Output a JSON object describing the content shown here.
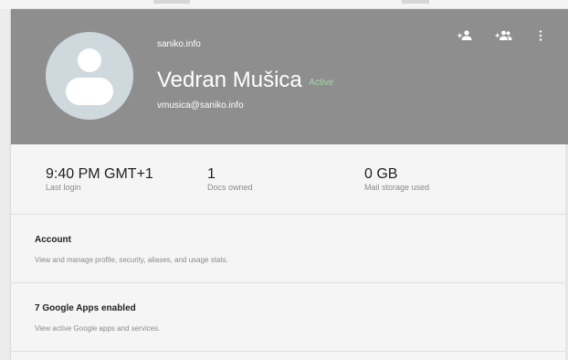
{
  "user": {
    "domain": "saniko.info",
    "name": "Vedran Mušica",
    "status": "Active",
    "email": "vmusica@saniko.info",
    "avatar_icon": "default-person-avatar-icon"
  },
  "header_actions": [
    {
      "icon": "person-add-icon"
    },
    {
      "icon": "group-add-icon"
    },
    {
      "icon": "more-vert-icon"
    }
  ],
  "stats": [
    {
      "value": "9:40 PM GMT+1",
      "label": "Last login"
    },
    {
      "value": "1",
      "label": "Docs owned"
    },
    {
      "value": "0 GB",
      "label": "Mail storage used"
    }
  ],
  "sections": [
    {
      "title": "Account",
      "description": "View and manage profile, security, aliases, and usage stats."
    },
    {
      "title": "7 Google Apps enabled",
      "description": "View active Google apps and services."
    }
  ],
  "colors": {
    "header_bg": "#8e8e8e",
    "status_active": "#a5d6a7",
    "avatar_bg": "#cfd8dc"
  }
}
